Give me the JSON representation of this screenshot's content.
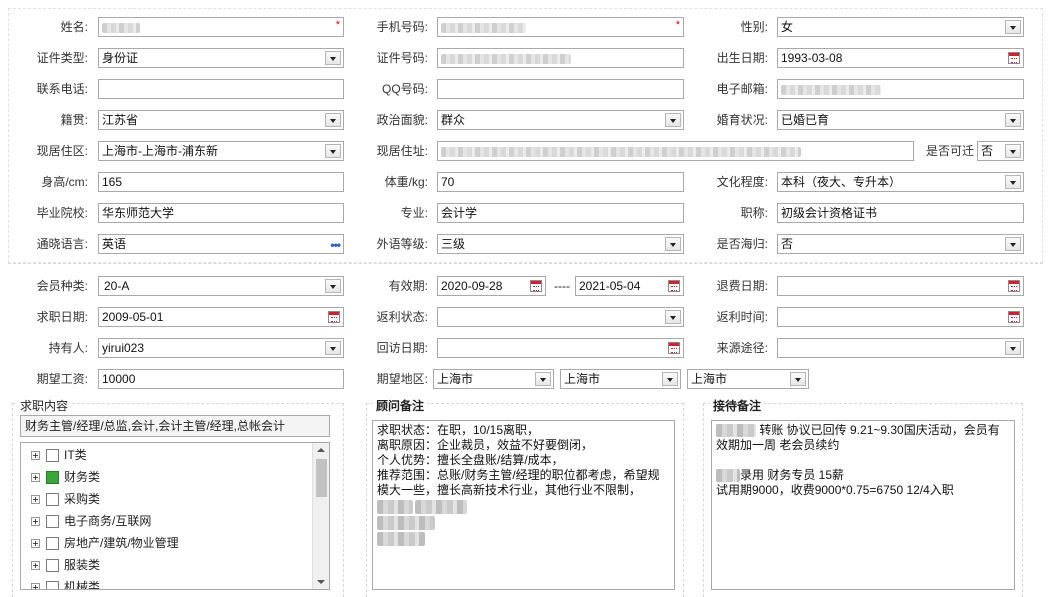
{
  "personal": {
    "name": {
      "label": "姓名:",
      "value": ""
    },
    "mobile": {
      "label": "手机号码:",
      "value": ""
    },
    "gender": {
      "label": "性别:",
      "value": "女"
    },
    "id_type": {
      "label": "证件类型:",
      "value": "身份证"
    },
    "id_number": {
      "label": "证件号码:",
      "value": ""
    },
    "birth_date": {
      "label": "出生日期:",
      "value": "1993-03-08"
    },
    "contact_phone": {
      "label": "联系电话:",
      "value": ""
    },
    "qq": {
      "label": "QQ号码:",
      "value": ""
    },
    "email": {
      "label": "电子邮箱:",
      "value": ""
    },
    "native_place": {
      "label": "籍贯:",
      "value": "江苏省"
    },
    "political_status": {
      "label": "政治面貌:",
      "value": "群众"
    },
    "marital_status": {
      "label": "婚育状况:",
      "value": "已婚已育"
    },
    "current_area": {
      "label": "现居住区:",
      "value": "上海市-上海市-浦东新"
    },
    "current_address": {
      "label": "现居住址:",
      "value": ""
    },
    "relocatable": {
      "label": "是否可迁",
      "value": "否"
    },
    "height": {
      "label": "身高/cm:",
      "value": "165"
    },
    "weight": {
      "label": "体重/kg:",
      "value": "70"
    },
    "education": {
      "label": "文化程度:",
      "value": "本科（夜大、专升本）"
    },
    "school": {
      "label": "毕业院校:",
      "value": "华东师范大学"
    },
    "major": {
      "label": "专业:",
      "value": "会计学"
    },
    "title": {
      "label": "职称:",
      "value": "初级会计资格证书"
    },
    "language": {
      "label": "通晓语言:",
      "value": "英语"
    },
    "foreign_level": {
      "label": "外语等级:",
      "value": "三级"
    },
    "returnee": {
      "label": "是否海归:",
      "value": "否"
    }
  },
  "membership": {
    "member_type": {
      "label": "会员种类:",
      "value": "20-A"
    },
    "validity": {
      "label": "有效期:",
      "start": "2020-09-28",
      "separator": "----",
      "end": "2021-05-04"
    },
    "refund_date": {
      "label": "退费日期:",
      "value": ""
    },
    "job_date": {
      "label": "求职日期:",
      "value": "2009-05-01"
    },
    "rebate_status": {
      "label": "返利状态:",
      "value": ""
    },
    "rebate_time": {
      "label": "返利时间:",
      "value": ""
    },
    "holder": {
      "label": "持有人:",
      "value": "yirui023"
    },
    "visit_date": {
      "label": "回访日期:",
      "value": ""
    },
    "source": {
      "label": "来源途径:",
      "value": ""
    },
    "expected_salary": {
      "label": "期望工资:",
      "value": "10000"
    },
    "expected_region": {
      "label": "期望地区:",
      "values": [
        "上海市",
        "上海市",
        "上海市"
      ]
    }
  },
  "job_content": {
    "title": "求职内容",
    "summary": "财务主管/经理/总监,会计,会计主管/经理,总帐会计",
    "categories": [
      {
        "label": "IT类",
        "checked": false
      },
      {
        "label": "财务类",
        "checked": true
      },
      {
        "label": "采购类",
        "checked": false
      },
      {
        "label": "电子商务/互联网",
        "checked": false
      },
      {
        "label": "房地产/建筑/物业管理",
        "checked": false
      },
      {
        "label": "服装类",
        "checked": false
      },
      {
        "label": "机械类",
        "checked": false
      }
    ]
  },
  "advisor_notes": {
    "title": "顾问备注",
    "lines": [
      "求职状态：在职，10/15离职，",
      "离职原因：企业裁员，效益不好要倒闭，",
      "个人优势：擅长全盘账/结算/成本，",
      "推荐范围：总账/财务主管/经理的职位都考虑，希望规",
      "模大一些，擅长高新技术行业，其他行业不限制，"
    ]
  },
  "reception_notes": {
    "title": "接待备注",
    "line1_a": "转账 协议已回传 9.21~9.30国庆活动，会员有",
    "line2": "效期加一周  老会员续约",
    "line4_a": "录用 财务专员  15薪",
    "line5": "试用期9000，收费9000*0.75=6750   12/4入职"
  }
}
